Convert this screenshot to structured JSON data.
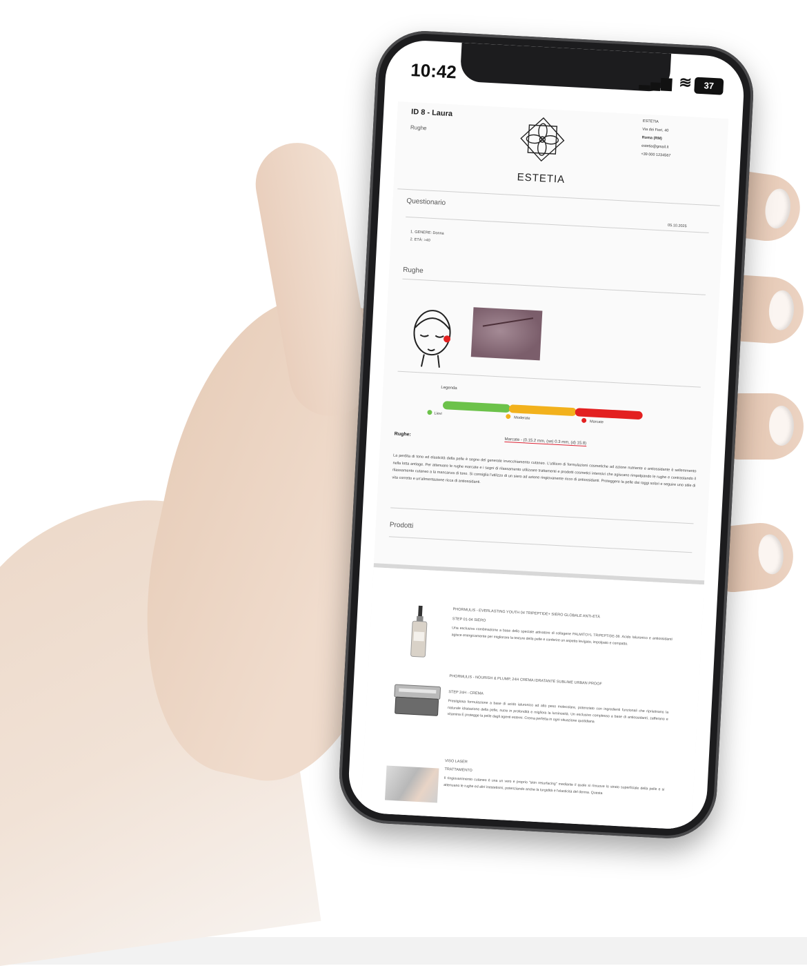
{
  "status_bar": {
    "time": "10:42",
    "battery": "37"
  },
  "header": {
    "id_name": "ID 8 - Laura",
    "subtitle": "Rughe",
    "brand": "ESTETIA",
    "contact": [
      "ESTETIA",
      "Via dei Fiori, 40",
      "Roma (RM)",
      "estetia@gmail.it",
      "+39 000 1234567"
    ]
  },
  "questionnaire": {
    "title": "Questionario",
    "date": "05.10.2025",
    "items": [
      "1. GENERE: Donna",
      "2. ETÀ: >40"
    ]
  },
  "rughe": {
    "title": "Rughe",
    "legend_label": "Legenda",
    "levels": [
      "Lievi",
      "Moderate",
      "Marcate"
    ],
    "colors": {
      "lievi": "#6cc24a",
      "moderate": "#f2b11c",
      "marcate": "#e32020"
    },
    "result_label": "Rughe:",
    "result_value": "Marcate - (0.15.2 mm, (se) 0.3 mm, (d) 15.8)",
    "description": "La perdita di tono ed elasticità della pelle è segno del generale invecchiamento cutaneo. L'utilizzo di formulazioni cosmetiche ad azione nutriente e antiossidante è sellemmento nella lotta antiage. Per attenuare le rughe marcate e i segni di rilassamento utilizzare trattamenti e prodotti cosmetici intensivi che agiscano rimpolpando le rughe e contrastando il rilassamento cutaneo a la mancanza di tono. Si consiglia l'utilizzo di un siero ad azione ringiovanente ricco di antiossidanti. Proteggere la pelle dai raggi solari e seguire uno stile di vita corretto e un'alimentazione ricca di antiossidanti."
  },
  "prodotti": {
    "title": "Prodotti",
    "items": [
      {
        "title": "PHORMULIS - EVERLASTING YOUTH 04 TRIPEPTIDE+ SIERO GLOBALE ANTI-ETÀ",
        "step": "STEP 01-04 SIERO",
        "description": "Una esclusiva combinazione a base dello speciale attivatore di collagene PALMITOYL TRIPEPTIDE-38. Acido Ialuronico e antiossidanti agisce energicamente per migliorare la texture della pelle e conferire un aspetto levigato, impolpato e compatto."
      },
      {
        "title": "PHORMULIS - NOURISH & PLUMP, 24H CREMA IDRATANTE SUBLIME URBAN PROOF",
        "step": "STEP 24H - CREMA",
        "description": "Prestigiosa formulazione a base di acido ialuronico ad alto peso molecolare, potenziato con ingredienti funzionali che ripristinano la naturale idratazione della pelle, nutre in profondità e migliora la luminosità. Un esclusivo complesso a base di antiossidanti, zafferano e vitamina E protegge la pelle dagli agenti esterni. Crema perfetta in ogni situazione quotidiana"
      },
      {
        "title": "VISO LASER",
        "step": "TRATTAMENTO",
        "description": "Il ringiovanimento cutaneo è una un vero e proprio \"skin resurfacing\" mediante il quale si rimuove lo strato superficiale della pelle e si attenuano le rughe ed altri inestetismi, potenziando anche la turgidità e l'elasticità del derma. Questa"
      }
    ]
  }
}
